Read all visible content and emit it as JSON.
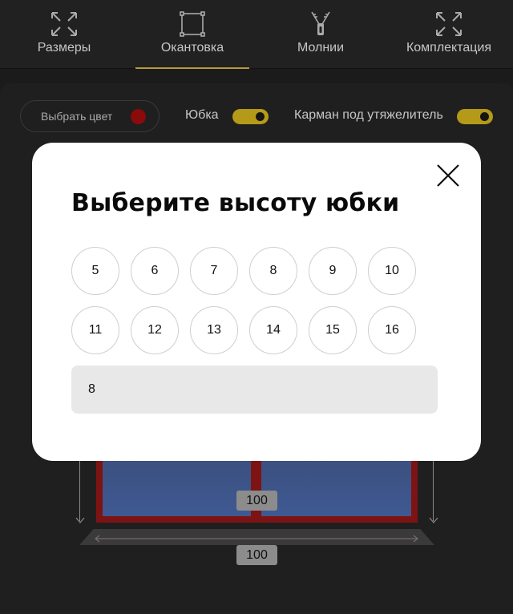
{
  "tabs": [
    {
      "label": "Размеры",
      "icon": "expand-arrows-icon",
      "active": false
    },
    {
      "label": "Окантовка",
      "icon": "frame-square-icon",
      "active": true
    },
    {
      "label": "Молнии",
      "icon": "zipper-icon",
      "active": false
    },
    {
      "label": "Комплектация",
      "icon": "expand-arrows-icon",
      "active": false
    }
  ],
  "options": {
    "color_button_label": "Выбрать цвет",
    "color_value": "#8b0a0a",
    "skirt_label": "Юбка",
    "skirt_on": true,
    "pocket_label": "Карман под утяжелитель",
    "pocket_on": true,
    "accent_color": "#b59a1a"
  },
  "preview": {
    "height_value": "100",
    "width_value": "100"
  },
  "modal": {
    "title": "Выберите высоту юбки",
    "close_icon": "close-x-icon",
    "sizes": [
      "5",
      "6",
      "7",
      "8",
      "9",
      "10",
      "11",
      "12",
      "13",
      "14",
      "15",
      "16"
    ],
    "input_value": "8"
  }
}
